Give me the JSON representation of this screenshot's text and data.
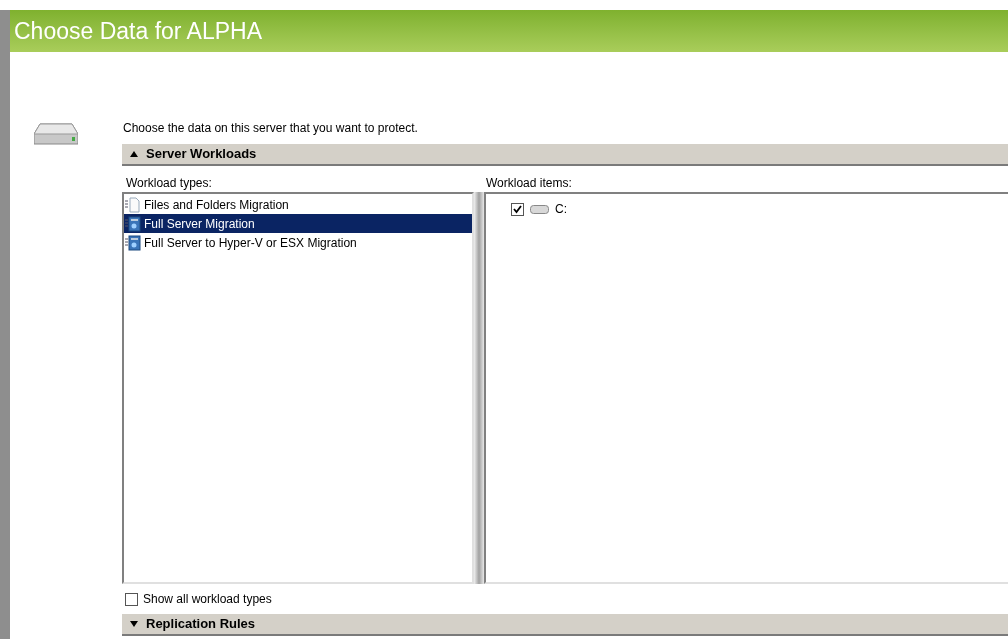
{
  "window": {
    "title": "Choose Data for ALPHA"
  },
  "intro": "Choose the data on this server that you want to protect.",
  "sections": [
    {
      "title": "Server Workloads",
      "expanded": true
    },
    {
      "title": "Replication Rules",
      "expanded": false
    }
  ],
  "workload_types": {
    "label": "Workload types:",
    "items": [
      {
        "label": "Files and Folders Migration",
        "kind": "files",
        "selected": false
      },
      {
        "label": "Full Server Migration",
        "kind": "server",
        "selected": true
      },
      {
        "label": "Full Server to Hyper-V or ESX Migration",
        "kind": "server",
        "selected": false
      }
    ]
  },
  "workload_items": {
    "label": "Workload items:",
    "items": [
      {
        "label": "C:",
        "checked": true
      }
    ]
  },
  "show_all": {
    "label": "Show all workload types",
    "checked": false
  }
}
